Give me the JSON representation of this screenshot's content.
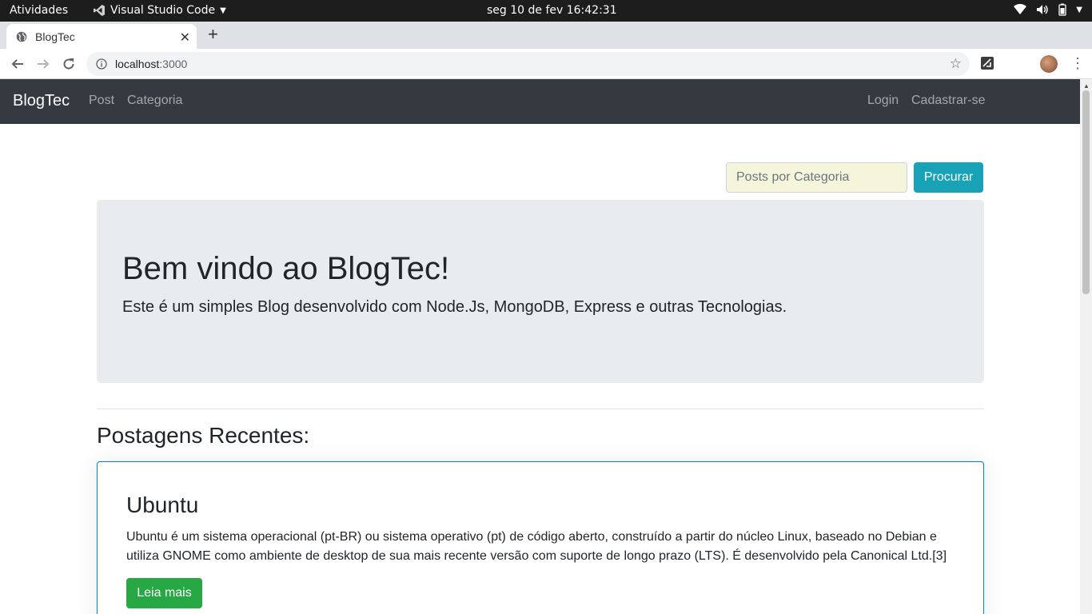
{
  "os_bar": {
    "activities": "Atividades",
    "app_name": "Visual Studio Code",
    "clock": "seg 10 de fev  16:42:31"
  },
  "browser": {
    "tab_title": "BlogTec",
    "url_host": "localhost",
    "url_port": ":3000"
  },
  "navbar": {
    "brand": "BlogTec",
    "links": [
      "Post",
      "Categoria"
    ],
    "right_links": [
      "Login",
      "Cadastrar-se"
    ]
  },
  "search": {
    "placeholder": "Posts por Categoria",
    "button": "Procurar"
  },
  "jumbotron": {
    "title": "Bem vindo ao BlogTec!",
    "lead": "Este é um simples Blog desenvolvido com Node.Js, MongoDB, Express e outras Tecnologias."
  },
  "recent": {
    "title": "Postagens Recentes:",
    "posts": [
      {
        "title": "Ubuntu",
        "excerpt": "Ubuntu é um sistema operacional (pt-BR) ou sistema operativo (pt) de código aberto, construído a partir do núcleo Linux, baseado no Debian e utiliza GNOME como ambiente de desktop de sua mais recente versão com suporte de longo prazo (LTS). É desenvolvido pela Canonical Ltd.[3]",
        "button": "Leia mais"
      }
    ]
  },
  "colors": {
    "navbar_bg": "#343a40",
    "info_button": "#17a2b8",
    "success_button": "#28a745",
    "card_border": "#007bff",
    "jumbotron_bg": "#e9ecef"
  }
}
